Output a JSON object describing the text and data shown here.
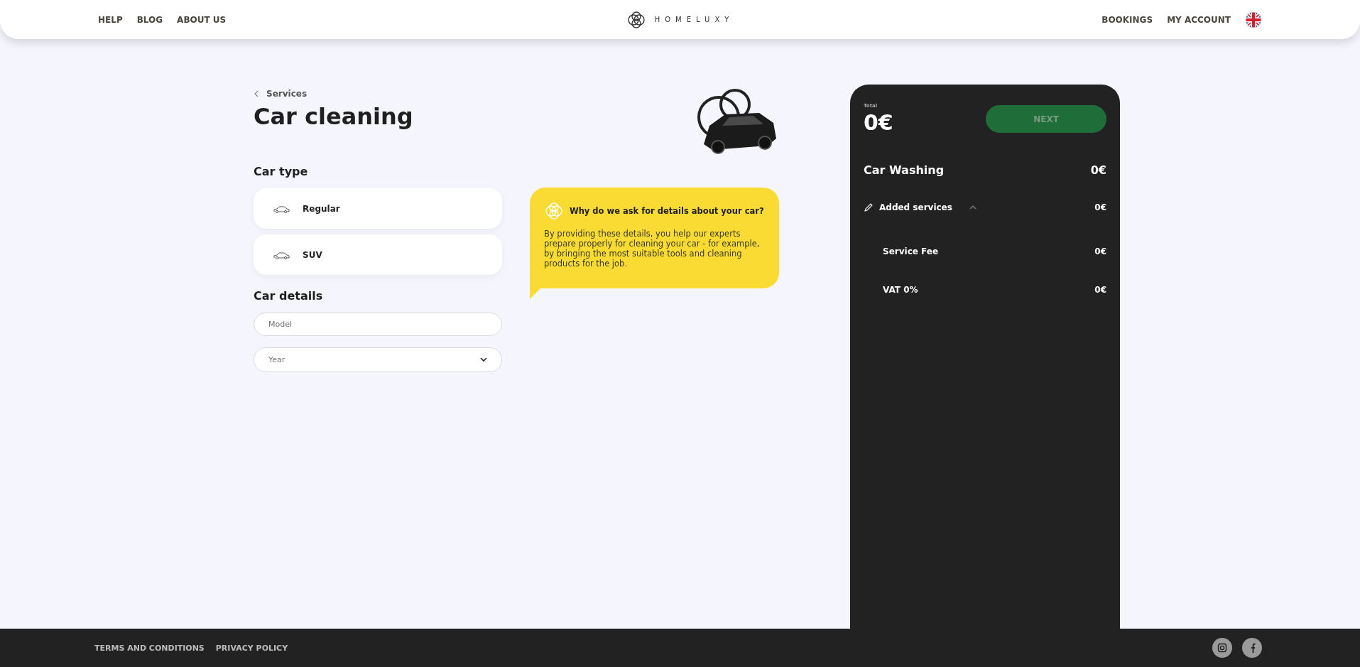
{
  "header": {
    "nav_left": [
      "HELP",
      "BLOG",
      "ABOUT US"
    ],
    "logo": "HOMELUXY",
    "nav_right": [
      "BOOKINGS",
      "MY ACCOUNT"
    ]
  },
  "breadcrumb": "Services",
  "title": "Car cleaning",
  "car_type": {
    "heading": "Car type",
    "options": [
      {
        "label": "Regular",
        "selected": false
      },
      {
        "label": "SUV",
        "selected": false
      }
    ]
  },
  "car_details": {
    "heading": "Car details",
    "fields": [
      {
        "kind": "text",
        "placeholder": "Model"
      },
      {
        "kind": "select",
        "placeholder": "Year"
      }
    ]
  },
  "info": {
    "title": "Why do we ask for details about your car?",
    "text": "By providing these details, you help our experts prepare properly for cleaning your car - for example, by bringing the most suitable tools and cleaning products for the job."
  },
  "summary": {
    "total_label": "Total",
    "total": "0€",
    "next_button": {
      "label": "NEXT",
      "disabled": true
    },
    "service": {
      "name": "Car Washing",
      "price": "0€"
    },
    "added_services": {
      "label": "Added services",
      "price": "0€",
      "expanded": true,
      "children": [
        {
          "name": "Service Fee",
          "price": "0€"
        },
        {
          "name": "VAT 0%",
          "price": "0€"
        }
      ]
    }
  },
  "footer": {
    "links": [
      "TERMS AND CONDITIONS",
      "PRIVACY POLICY"
    ]
  }
}
